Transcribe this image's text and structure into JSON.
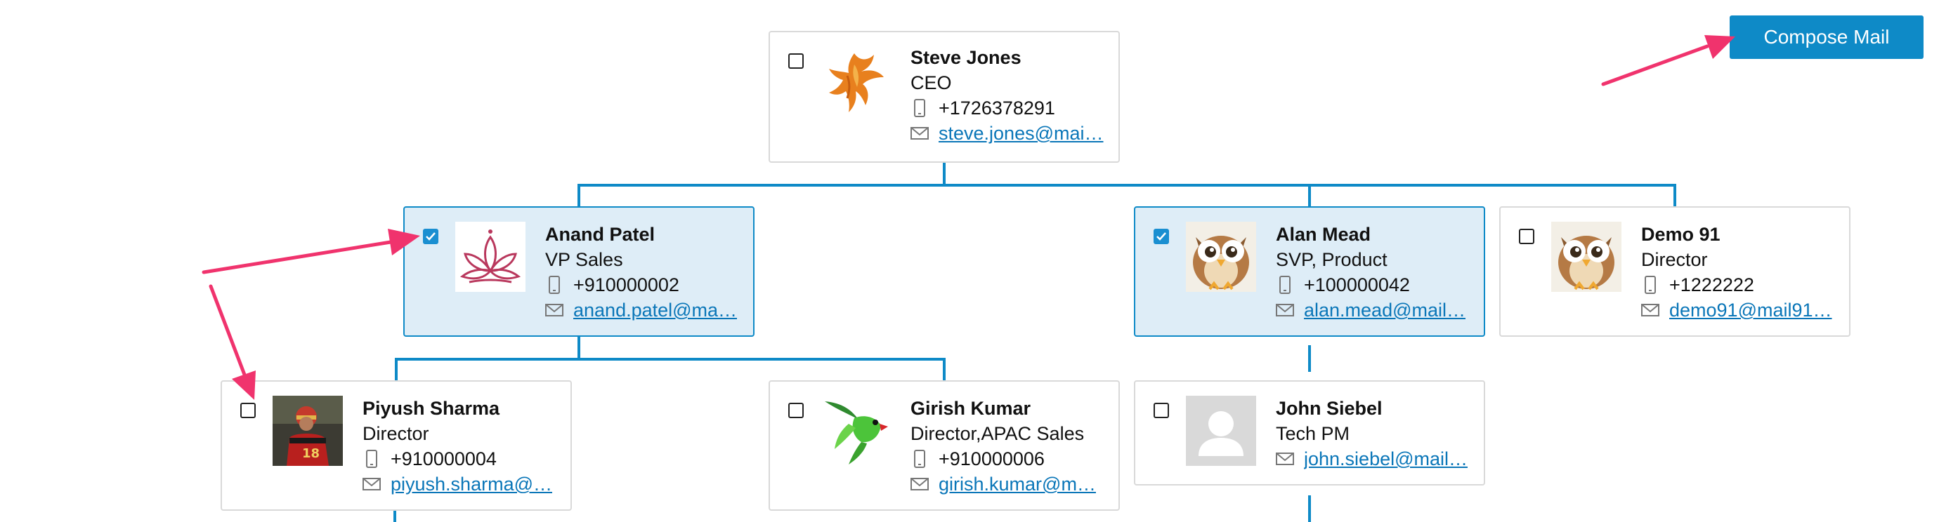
{
  "toolbar": {
    "compose_label": "Compose Mail"
  },
  "colors": {
    "accent": "#0e8ac7",
    "selected_bg": "#deedf7",
    "connector": "#0e8ac7",
    "annotation_arrow": "#f0336d"
  },
  "people": [
    {
      "name": "Steve Jones",
      "title": "CEO",
      "phone": "+1726378291",
      "email": "steve.jones@mai…",
      "checked": false,
      "avatar_icon": "phoenix-avatar-icon"
    },
    {
      "name": "Anand Patel",
      "title": "VP Sales",
      "phone": "+910000002",
      "email": "anand.patel@ma…",
      "checked": true,
      "avatar_icon": "lotus-avatar-icon"
    },
    {
      "name": "Alan Mead",
      "title": "SVP, Product",
      "phone": "+100000042",
      "email": "alan.mead@mail…",
      "checked": true,
      "avatar_icon": "owl-avatar-icon"
    },
    {
      "name": "Demo 91",
      "title": "Director",
      "phone": "+1222222",
      "email": "demo91@mail91…",
      "checked": false,
      "avatar_icon": "owl-avatar-icon"
    },
    {
      "name": "Piyush Sharma",
      "title": "Director",
      "phone": "+910000004",
      "email": "piyush.sharma@…",
      "checked": false,
      "avatar_icon": "cricketer-photo-icon"
    },
    {
      "name": "Girish Kumar",
      "title": "Director,APAC Sales",
      "phone": "+910000006",
      "email": "girish.kumar@m…",
      "checked": false,
      "avatar_icon": "parrot-avatar-icon"
    },
    {
      "name": "John Siebel",
      "title": "Tech PM",
      "phone": null,
      "email": "john.siebel@mail…",
      "checked": false,
      "avatar_icon": "default-user-avatar-icon"
    }
  ]
}
